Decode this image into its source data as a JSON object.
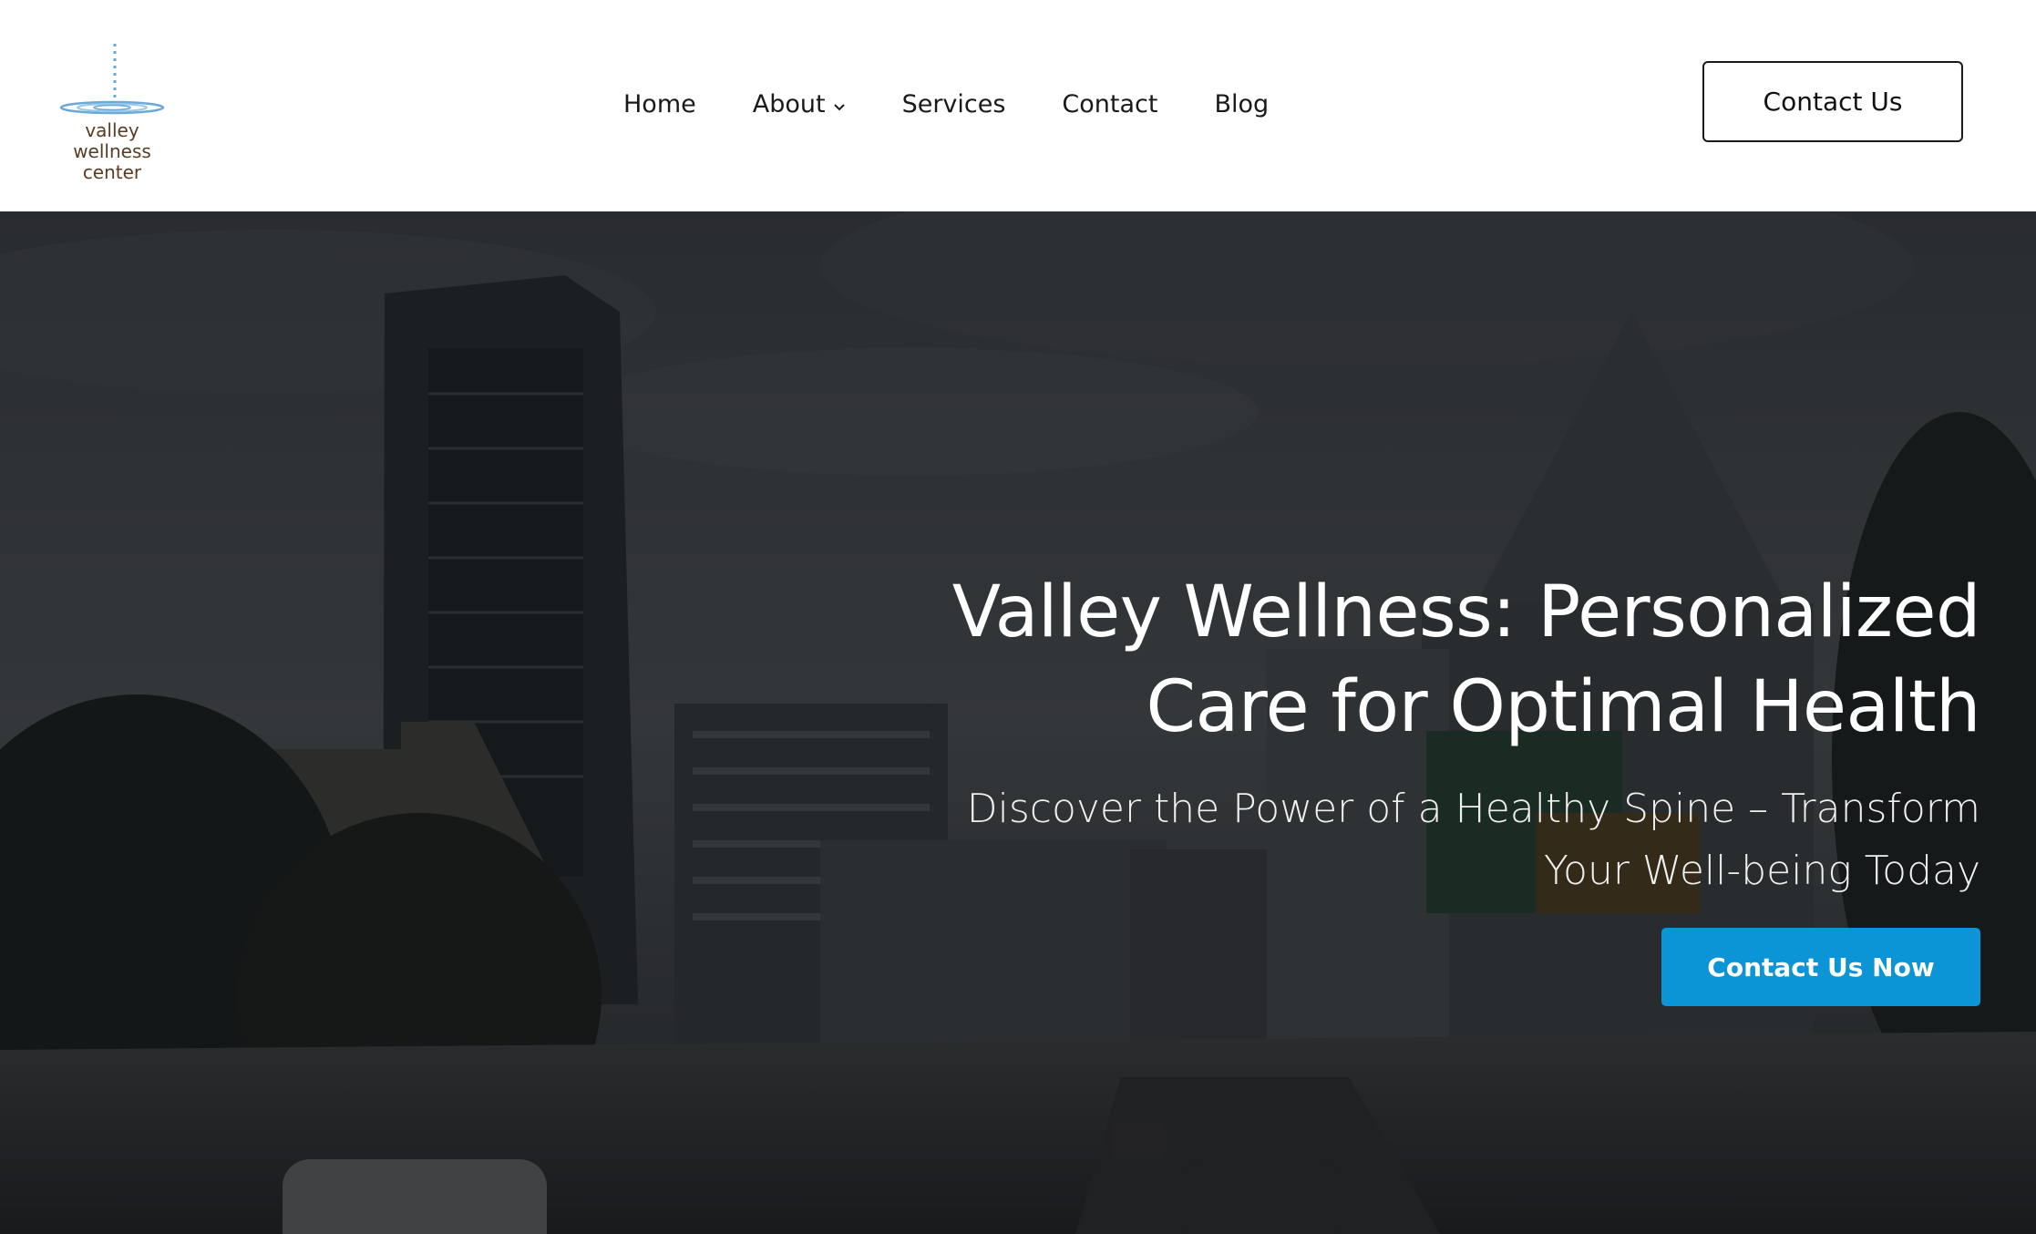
{
  "brand": {
    "logo_line1": "valley",
    "logo_line2": "wellness center",
    "logo_color": "#5a3b22",
    "logo_accent": "#6aa9d8"
  },
  "nav": {
    "items": [
      {
        "label": "Home",
        "icon": null
      },
      {
        "label": "About",
        "icon": "chevron-down-icon"
      },
      {
        "label": "Services",
        "icon": null
      },
      {
        "label": "Contact",
        "icon": null
      },
      {
        "label": "Blog",
        "icon": null
      }
    ]
  },
  "header": {
    "cta_label": "Contact Us"
  },
  "hero": {
    "title": "Valley Wellness: Personalized Care for Optimal Health",
    "subtitle": "Discover the Power of a Healthy Spine – Transform Your Well-being Today",
    "cta_label": "Contact Us Now",
    "cta_color": "#0b95d6",
    "background": "dark city skyline with highway"
  }
}
